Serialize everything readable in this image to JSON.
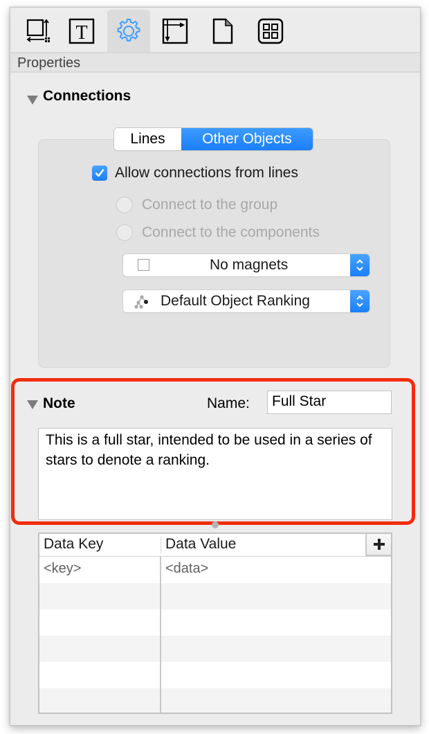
{
  "toolbar": {
    "tabs": [
      {
        "icon": "geometry-icon",
        "active": false
      },
      {
        "icon": "text-icon",
        "active": false
      },
      {
        "icon": "gear-icon",
        "active": true
      },
      {
        "icon": "canvas-size-icon",
        "active": false
      },
      {
        "icon": "document-icon",
        "active": false
      },
      {
        "icon": "grid-icon",
        "active": false
      }
    ],
    "accent_color": "#3d9bff"
  },
  "properties_label": "Properties",
  "connections": {
    "title": "Connections",
    "segments": [
      "Lines",
      "Other Objects"
    ],
    "selected_segment": "Other Objects",
    "allow_connections": {
      "label": "Allow connections from lines",
      "checked": true
    },
    "radio_group": {
      "label": "Connect to the group",
      "selected": false,
      "enabled": false
    },
    "radio_components": {
      "label": "Connect to the components",
      "selected": false,
      "enabled": false
    },
    "magnets_popup": {
      "value": "No magnets"
    },
    "ranking_popup": {
      "value": "Default Object Ranking"
    }
  },
  "note": {
    "title": "Note",
    "name_label": "Name:",
    "name_value": "Full Star",
    "text": "This is a full star, intended to be used in a series of stars to denote a ranking.",
    "highlight_color": "#f22c0d"
  },
  "data_table": {
    "columns": [
      "Data Key",
      "Data Value"
    ],
    "add_label": "+",
    "rows": [
      {
        "key": "<key>",
        "value": "<data>"
      }
    ]
  }
}
